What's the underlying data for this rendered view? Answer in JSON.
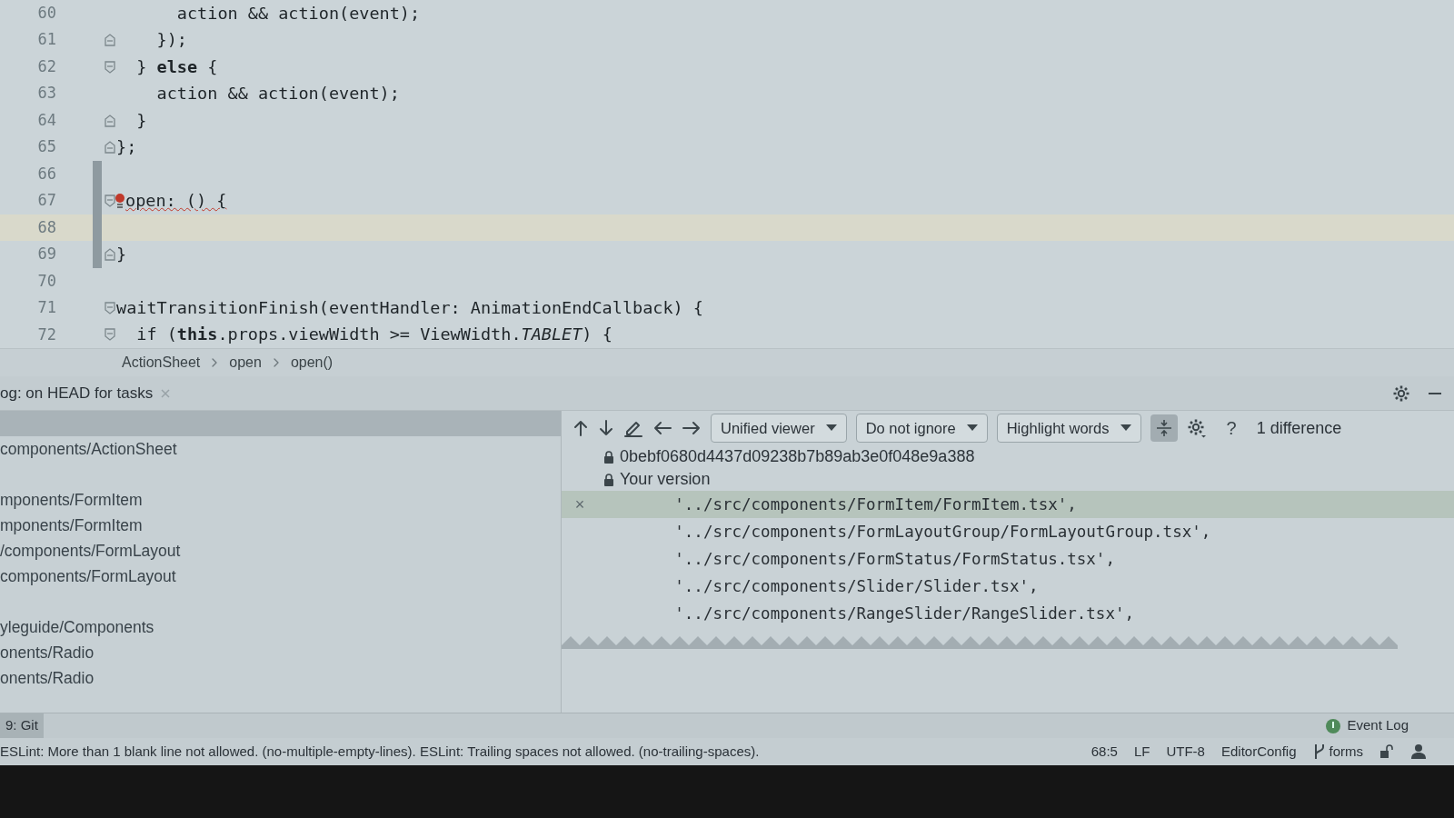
{
  "editor": {
    "lines": [
      {
        "number": "60",
        "code": "      action && action(event);",
        "fold_start": false,
        "fold_end": false
      },
      {
        "number": "61",
        "code": "    });",
        "fold_start": false,
        "fold_end": true
      },
      {
        "number": "62",
        "code": "  } **else** {",
        "fold_start": true,
        "fold_end": false
      },
      {
        "number": "63",
        "code": "    action && action(event);",
        "fold_start": false,
        "fold_end": false
      },
      {
        "number": "64",
        "code": "  }",
        "fold_start": false,
        "fold_end": true
      },
      {
        "number": "65",
        "code": "};",
        "fold_start": false,
        "fold_end": true
      },
      {
        "number": "66",
        "modified": true,
        "fold_start": false,
        "fold_end": false
      },
      {
        "number": "67",
        "code": "open: () {",
        "modified": true,
        "fold_start": true,
        "fold_end": false,
        "error": true
      },
      {
        "number": "68",
        "modified": true,
        "current": true,
        "fold_start": false,
        "fold_end": false
      },
      {
        "number": "69",
        "code": "}",
        "modified": true,
        "fold_start": false,
        "fold_end": true
      },
      {
        "number": "70",
        "fold_start": false,
        "fold_end": false
      },
      {
        "number": "71",
        "code": "waitTransitionFinish(eventHandler: AnimationEndCallback) {",
        "fold_start": true,
        "fold_end": false
      },
      {
        "number": "72",
        "code": "  if (**this**.props.viewWidth >= ViewWidth.*TABLET*) {",
        "fold_start": true,
        "fold_end": false
      }
    ],
    "breadcrumbs": [
      "ActionSheet",
      "open",
      "open()"
    ]
  },
  "tool_window": {
    "title": "og: on HEAD for tasks",
    "file_groups": [
      [
        "components/ActionSheet"
      ],
      [
        "mponents/FormItem",
        "mponents/FormItem",
        "/components/FormLayout",
        "components/FormLayout"
      ],
      [
        "yleguide/Components",
        "onents/Radio",
        "onents/Radio"
      ]
    ],
    "diff": {
      "toolbar": {
        "dropdowns": [
          "Unified viewer",
          "Do not ignore",
          "Highlight words"
        ],
        "collapse_on": true,
        "help": "?",
        "count": "1 difference"
      },
      "headers": [
        "0bebf0680d4437d09238b7b89ab3e0f048e9a388",
        "Your version"
      ],
      "lines": [
        {
          "code": "        '../src/components/FormItem/FormItem.tsx',",
          "changed": true,
          "marker": "×"
        },
        {
          "code": "        '../src/components/FormLayoutGroup/FormLayoutGroup.tsx',",
          "changed": false
        },
        {
          "code": "        '../src/components/FormStatus/FormStatus.tsx',",
          "changed": false
        },
        {
          "code": "        '../src/components/Slider/Slider.tsx',",
          "changed": false
        },
        {
          "code": "        '../src/components/RangeSlider/RangeSlider.tsx',",
          "changed": false
        }
      ]
    }
  },
  "bottom_tabs": [
    {
      "label": "9: Git",
      "selected": true
    }
  ],
  "event_log": "Event Log",
  "status_bar": {
    "message": "ESLint: More than 1 blank line not allowed. (no-multiple-empty-lines). ESLint: Trailing spaces not allowed. (no-trailing-spaces).",
    "position": "68:5",
    "line_separator": "LF",
    "encoding": "UTF-8",
    "code_style": "EditorConfig",
    "branch": "forms"
  }
}
